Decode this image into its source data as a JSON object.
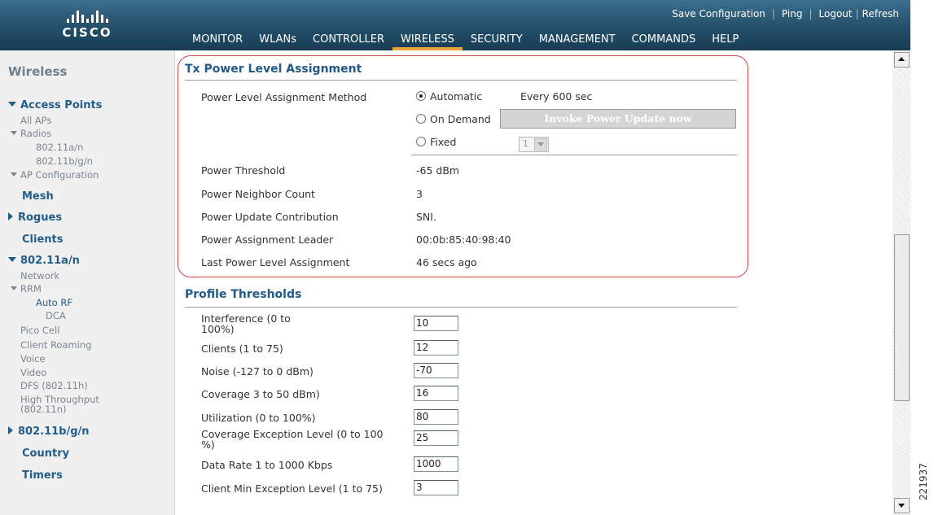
{
  "brand": {
    "logo_text": "CISCO"
  },
  "utility_links": [
    "Save Configuration",
    "Ping",
    "Logout",
    "Refresh"
  ],
  "nav": {
    "tabs": [
      "MONITOR",
      "WLANs",
      "CONTROLLER",
      "WIRELESS",
      "SECURITY",
      "MANAGEMENT",
      "COMMANDS",
      "HELP"
    ],
    "active": "WIRELESS"
  },
  "sidebar": {
    "title": "Wireless",
    "access_points": "Access Points",
    "all_aps": "All APs",
    "radios": "Radios",
    "r_80211an": "802.11a/n",
    "r_80211bgn": "802.11b/g/n",
    "ap_config": "AP Configuration",
    "mesh": "Mesh",
    "rogues": "Rogues",
    "clients": "Clients",
    "band_a": "802.11a/n",
    "network": "Network",
    "rrm": "RRM",
    "auto_rf": "Auto RF",
    "dca": "DCA",
    "pico_cell": "Pico Cell",
    "client_roaming": "Client Roaming",
    "voice": "Voice",
    "video": "Video",
    "dfs": "DFS (802.11h)",
    "ht_line1": "High Throughput",
    "ht_line2": "(802.11n)",
    "band_bg": "802.11b/g/n",
    "country": "Country",
    "timers": "Timers"
  },
  "tx_power": {
    "title": "Tx Power Level Assignment",
    "method_label": "Power Level Assignment Method",
    "opt_automatic": "Automatic",
    "automatic_interval": "Every 600 sec",
    "opt_on_demand": "On Demand",
    "invoke_button": "Invoke Power Update now",
    "opt_fixed": "Fixed",
    "fixed_value": "1",
    "selected": "Automatic",
    "rows": [
      {
        "label": "Power Threshold",
        "value": "-65 dBm"
      },
      {
        "label": "Power Neighbor Count",
        "value": "3"
      },
      {
        "label": "Power Update Contribution",
        "value": "SNI."
      },
      {
        "label": "Power Assignment Leader",
        "value": "00:0b:85:40:98:40"
      },
      {
        "label": "Last Power Level Assignment",
        "value": "46 secs ago"
      }
    ]
  },
  "profile_thresholds": {
    "title": "Profile Thresholds",
    "rows": [
      {
        "label_l1": "Interference (0 to",
        "label_l2": "100%)",
        "value": "10"
      },
      {
        "label_l1": "Clients (1 to 75)",
        "label_l2": "",
        "value": "12"
      },
      {
        "label_l1": "Noise (-127 to 0 dBm)",
        "label_l2": "",
        "value": "-70"
      },
      {
        "label_l1": "Coverage 3 to 50 dBm)",
        "label_l2": "",
        "value": "16"
      },
      {
        "label_l1": "Utilization (0 to 100%)",
        "label_l2": "",
        "value": "80"
      },
      {
        "label_l1": "Coverage Exception Level (0 to 100",
        "label_l2": "%)",
        "value": "25"
      },
      {
        "label_l1": "Data Rate 1 to 1000 Kbps",
        "label_l2": "",
        "value": "1000"
      },
      {
        "label_l1": "Client Min Exception Level (1 to 75)",
        "label_l2": "",
        "value": "3"
      }
    ]
  },
  "figure_id": "221937"
}
